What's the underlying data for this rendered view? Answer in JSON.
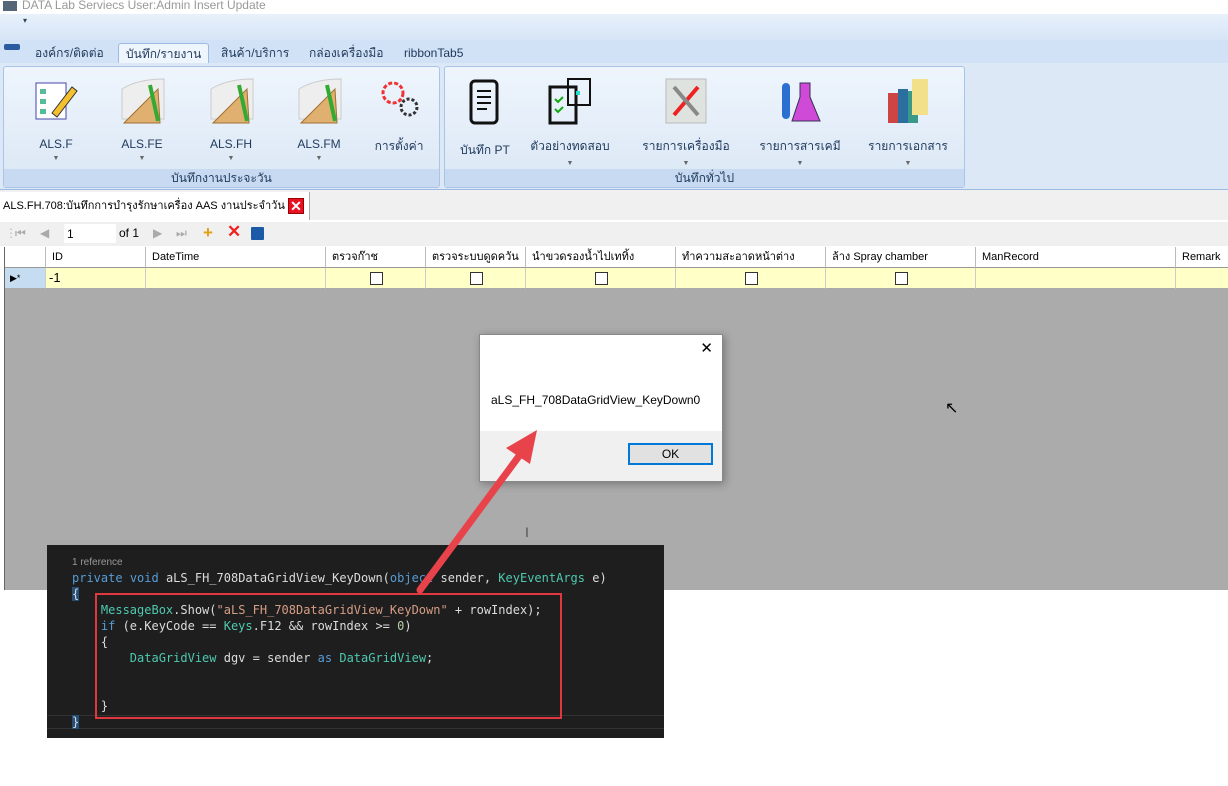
{
  "window": {
    "title": "DATA Lab Serviecs User:Admin Insert Update"
  },
  "tabs": [
    {
      "label": "องค์กร/ติดต่อ"
    },
    {
      "label": "บันทึก/รายงาน"
    },
    {
      "label": "สินค้า/บริการ"
    },
    {
      "label": "กล่องเครื่องมือ"
    },
    {
      "label": "ribbonTab5"
    }
  ],
  "ribbon": {
    "groups": [
      {
        "label": "บันทึกงานประจะวัน",
        "buttons": [
          {
            "label": "ALS.F",
            "icon": "checklist-pencil-icon"
          },
          {
            "label": "ALS.FE",
            "icon": "ruler-pencil-icon"
          },
          {
            "label": "ALS.FH",
            "icon": "ruler-pencil-icon"
          },
          {
            "label": "ALS.FM",
            "icon": "ruler-pencil-icon"
          },
          {
            "label": "การตั้งค่า",
            "icon": "gears-icon"
          }
        ]
      },
      {
        "label": "บันทึกทั่วไป",
        "buttons": [
          {
            "label": "บันทึก PT",
            "icon": "notebook-icon"
          },
          {
            "label": "ตัวอย่างทดสอบ",
            "icon": "clipboard-box-icon"
          },
          {
            "label": "รายการเครื่องมือ",
            "icon": "tools-icon"
          },
          {
            "label": "รายการสารเคมี",
            "icon": "flask-icon"
          },
          {
            "label": "รายการเอกสาร",
            "icon": "books-icon"
          }
        ]
      }
    ]
  },
  "document_tab": {
    "label": "ALS.FH.708:บันทึกการบำรุงรักษาเครื่อง AAS งานประจำวัน"
  },
  "navigator": {
    "position": "1",
    "of_label": "of 1"
  },
  "grid": {
    "columns": [
      "ID",
      "DateTime",
      "ตรวจก๊าช",
      "ตรวจระบบดูดควัน",
      "นำขวดรองน้ำไปเททิ้ง",
      "ทำความสะอาดหน้าต่าง",
      "ล้าง Spray chamber",
      "ManRecord",
      "Remark"
    ],
    "new_row": {
      "id": "-1"
    }
  },
  "dialog": {
    "message": "aLS_FH_708DataGridView_KeyDown0",
    "ok_label": "OK"
  },
  "code": {
    "reference": "1 reference",
    "lines": [
      "private void aLS_FH_708DataGridView_KeyDown(object sender, KeyEventArgs e)",
      "{",
      "    MessageBox.Show(\"aLS_FH_708DataGridView_KeyDown\" + rowIndex);",
      "    if (e.KeyCode == Keys.F12 && rowIndex >= 0)",
      "    {",
      "        DataGridView dgv = sender as DataGridView;",
      "    }",
      "}"
    ]
  },
  "colors": {
    "highlight_box": "#e0383e",
    "arrow": "#e8434a",
    "row_new": "#ffffc8"
  }
}
